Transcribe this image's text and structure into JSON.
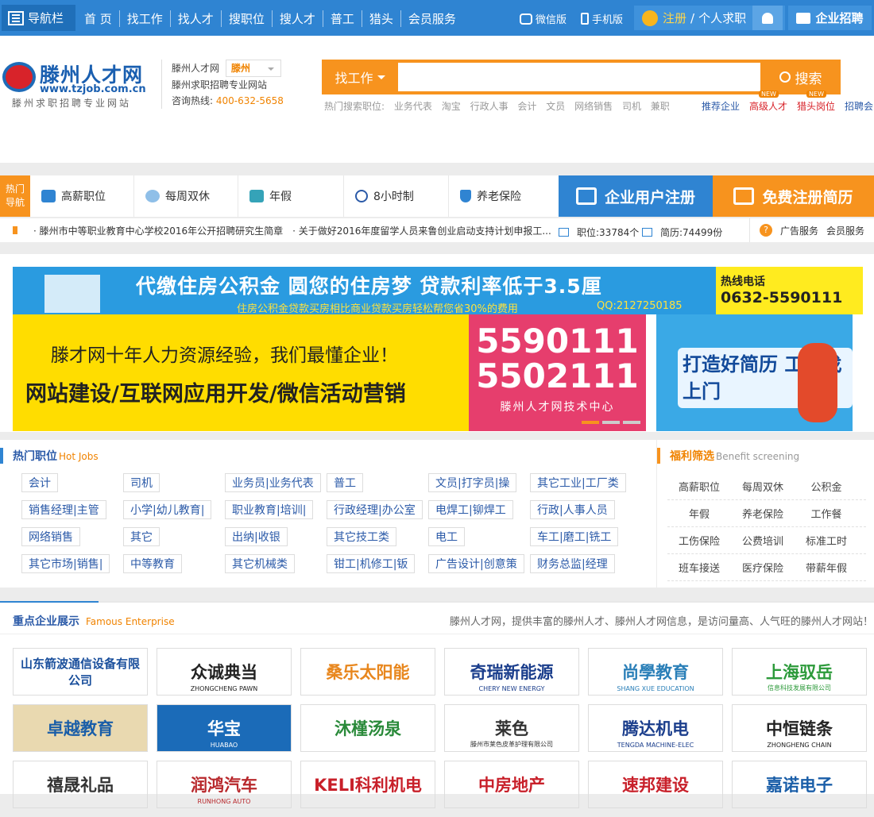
{
  "topbar": {
    "nav_label": "导航栏",
    "nav_links": [
      "首 页",
      "找工作",
      "找人才",
      "搜职位",
      "搜人才",
      "普工",
      "猎头",
      "会员服务"
    ],
    "wechat": "微信版",
    "mobile": "手机版",
    "register": "注册",
    "personal": "个人求职",
    "enterprise": "企业招聘"
  },
  "header": {
    "logo_title": "滕州人才网",
    "logo_url": "www.tzjob.com.cn",
    "logo_slogan": "滕州求职招聘专业网站",
    "site_name": "滕州人才网",
    "city": "滕州",
    "site_desc": "滕州求职招聘专业网站",
    "hotline_label": "咨询热线:",
    "hotline": "400-632-5658",
    "search_kind": "找工作",
    "search_button": "搜索",
    "search_value": "",
    "hot_label": "热门搜索职位:",
    "hot_terms": [
      "业务代表",
      "淘宝",
      "行政人事",
      "会计",
      "文员",
      "网络销售",
      "司机",
      "兼职"
    ],
    "top_links": [
      "推荐企业",
      "高级人才",
      "猎头岗位",
      "招聘会"
    ],
    "new_badge": "NEW"
  },
  "benefits": {
    "nav_label_1": "热门",
    "nav_label_2": "导航",
    "items": [
      "高薪职位",
      "每周双休",
      "年假",
      "8小时制",
      "养老保险"
    ],
    "register_enterprise": "企业用户注册",
    "register_resume": "免费注册简历"
  },
  "news": {
    "items": [
      "· 滕州市中等职业教育中心学校2016年公开招聘研究生简章",
      "· 关于做好2016年度留学人员来鲁创业启动支持计划申报工..."
    ],
    "jobs_stat": "职位:33784个",
    "resume_stat": "简历:74499份",
    "ad_service": "广告服务",
    "member_service": "会员服务"
  },
  "banners": {
    "fund_title": "代缴住房公积金 圆您的住房梦 贷款利率低于3.5厘",
    "fund_sub": "住房公积金贷款买房相比商业贷款买房轻松帮您省30%的费用",
    "fund_qq": "QQ:2127250185",
    "fund_hot_label": "热线电话",
    "fund_hot_tel": "0632-5590111",
    "web_line1": "滕才网十年人力资源经验，我们最懂企业！",
    "web_line2": "网站建设/互联网应用开发/微信活动营销",
    "web_tel1": "5590111",
    "web_tel2": "5502111",
    "web_center": "滕州人才网技术中心",
    "resume_ad": "打造好简历 工作找上门"
  },
  "hot_jobs": {
    "title": "热门职位",
    "title_en": "Hot Jobs",
    "rows": [
      [
        "会计",
        "司机",
        "业务员|业务代表",
        "普工",
        "文员|打字员|操",
        "其它工业|工厂类"
      ],
      [
        "销售经理|主管",
        "小学|幼儿教育|",
        "职业教育|培训|",
        "行政经理|办公室",
        "电焊工|铆焊工",
        "行政|人事人员"
      ],
      [
        "网络销售",
        "其它",
        "出纳|收银",
        "其它技工类",
        "电工",
        "车工|磨工|铣工"
      ],
      [
        "其它市场|销售|",
        "中等教育",
        "其它机械类",
        "钳工|机修工|钣",
        "广告设计|创意策",
        "财务总监|经理"
      ]
    ]
  },
  "welfare": {
    "title": "福利筛选",
    "title_en": "Benefit screening",
    "rows": [
      [
        "高薪职位",
        "每周双休",
        "公积金"
      ],
      [
        "年假",
        "养老保险",
        "工作餐"
      ],
      [
        "工伤保险",
        "公费培训",
        "标准工时"
      ],
      [
        "班车接送",
        "医疗保险",
        "带薪年假"
      ]
    ]
  },
  "famous": {
    "title": "重点企业展示",
    "title_en": "Famous Enterprise",
    "desc": "滕州人才网，提供丰富的滕州人才、滕州人才网信息，是访问量高、人气旺的滕州人才网站！",
    "rows": [
      [
        {
          "name": "山东箭波通信设备有限公司",
          "sub": "",
          "color": "#1a4f9c"
        },
        {
          "name": "众诚典当",
          "sub": "ZHONGCHENG PAWN",
          "color": "#222222"
        },
        {
          "name": "桑乐太阳能",
          "sub": "",
          "color": "#e8871e"
        },
        {
          "name": "奇瑞新能源",
          "sub": "CHERY NEW ENERGY",
          "color": "#1b3e8c"
        },
        {
          "name": "尚學教育",
          "sub": "SHANG XUE EDUCATION",
          "color": "#2a7fb8"
        },
        {
          "name": "上海驭岳",
          "sub": "信息科技发展有限公司",
          "color": "#2c9a3a"
        }
      ],
      [
        {
          "name": "卓越教育",
          "sub": "",
          "color": "#1a5ea8"
        },
        {
          "name": "华宝",
          "sub": "HUABAO",
          "color": "#ffffff"
        },
        {
          "name": "沐槿汤泉",
          "sub": "",
          "color": "#2a8a3a"
        },
        {
          "name": "莱色",
          "sub": "滕州市莱色皮革护理有限公司",
          "color": "#333333"
        },
        {
          "name": "腾达机电",
          "sub": "TENGDA MACHINE-ELEC",
          "color": "#1b3e8c"
        },
        {
          "name": "中恒链条",
          "sub": "ZHONGHENG CHAIN",
          "color": "#222222"
        }
      ],
      [
        {
          "name": "禧晟礼品",
          "sub": "",
          "color": "#333333"
        },
        {
          "name": "润鸿汽车",
          "sub": "RUNHONG AUTO",
          "color": "#b8282c"
        },
        {
          "name": "KELI科利机电",
          "sub": "",
          "color": "#c8202a"
        },
        {
          "name": "中房地产",
          "sub": "",
          "color": "#c8202a"
        },
        {
          "name": "速邦建设",
          "sub": "",
          "color": "#c8202a"
        },
        {
          "name": "嘉诺电子",
          "sub": "",
          "color": "#1a5ea8"
        }
      ]
    ]
  }
}
